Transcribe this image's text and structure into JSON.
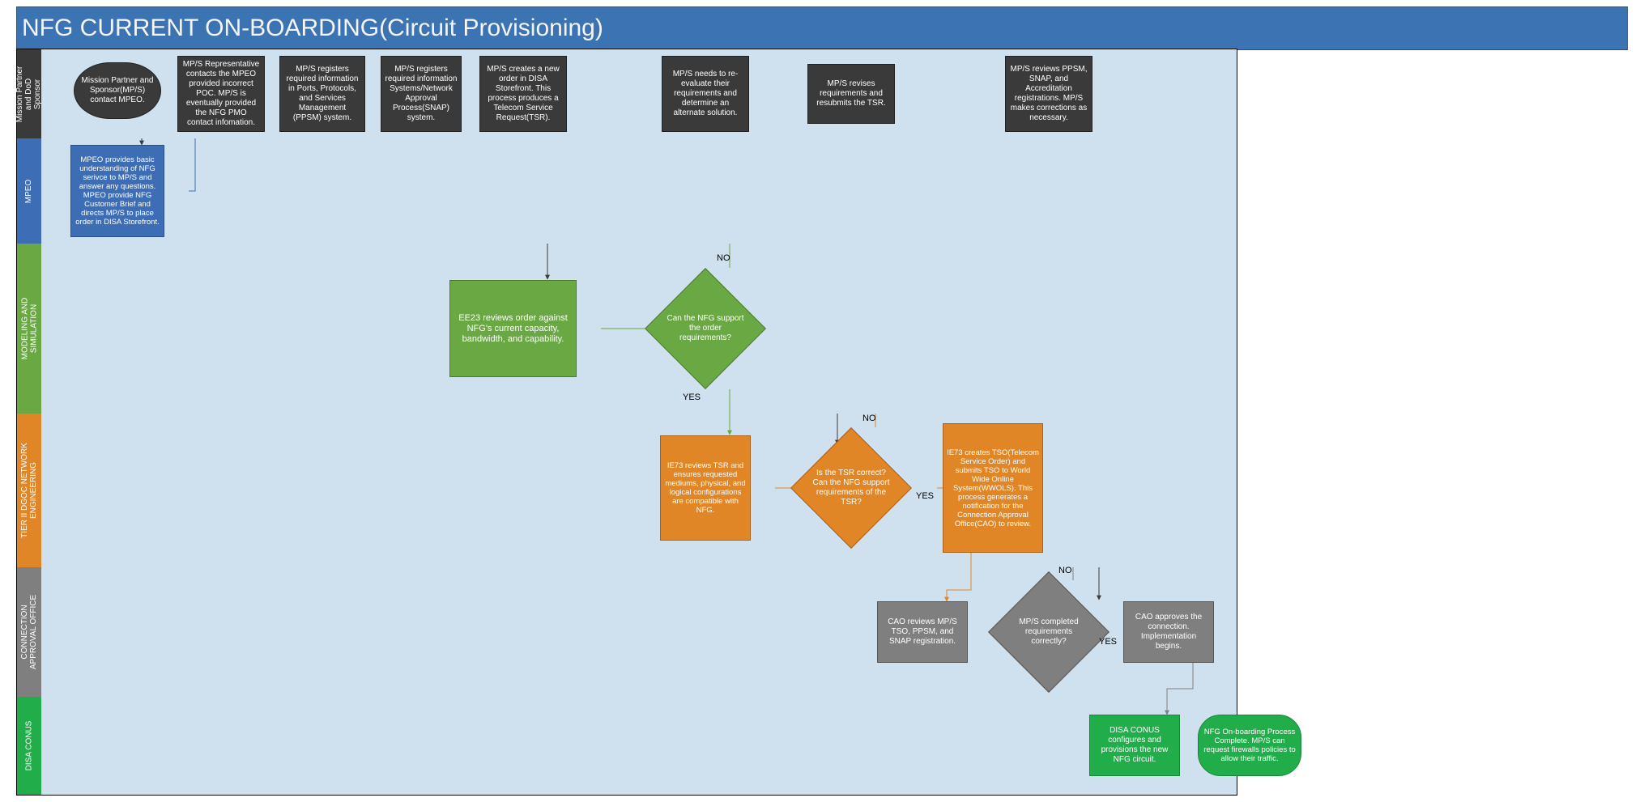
{
  "title": "NFG CURRENT ON-BOARDING(Circuit Provisioning)",
  "lanes": {
    "mp": "Mission Partner\nand DoD\nSponsor",
    "mpeo": "MPEO",
    "ms": "MODELING AND\nSIMULATION",
    "ne": "TIER II DGOC NETWORK\nENGINEERING",
    "cao": "CONNECTION\nAPPROVAL OFFICE",
    "dc": "DISA CONUS"
  },
  "nodes": {
    "a1": "Mission Partner and Sponsor(MP/S) contact MPEO.",
    "a2": "MP/S Representative contacts the MPEO provided incorrect POC. MP/S is eventually provided the NFG PMO contact infomation.",
    "a3": "MP/S  registers required information in Ports, Protocols, and Services Management (PPSM) system.",
    "a4": "MP/S  registers required information Systems/Network Approval Process(SNAP) system.",
    "a5": "MP/S creates a new order in DISA Storefront. This process produces a Telecom Service Request(TSR).",
    "a6": "MP/S needs to re-evaluate their requirements and determine an alternate solution.",
    "a7": "MP/S revises requirements and resubmits the TSR.",
    "a8": "MP/S reviews PPSM, SNAP, and Accreditation registrations. MP/S makes corrections as necessary.",
    "b1": "MPEO provides basic understanding of NFG serivce to MP/S and answer any questions. MPEO provide NFG Customer Brief and directs MP/S to place order in DISA Storefront.",
    "c1": "EE23 reviews order against NFG's current capacity, bandwidth, and capability.",
    "d1": "Can the NFG support the order requirements?",
    "e1": "IE73 reviews TSR and ensures requested mediums, physical, and logical configurations are compatible with NFG.",
    "d2": "Is the TSR correct? Can the NFG support requirements of the TSR?",
    "e2": "IE73 creates TSO(Telecom Service Order) and submits TSO to World Wide Online System(WWOLS). This process generates a notification for the Connection Approval Office(CAO) to review.",
    "f1": "CAO reviews MP/S TSO, PPSM, and SNAP registration.",
    "d3": "MP/S completed requirements correctly?",
    "f2": "CAO approves the connection. Implementation begins.",
    "g1": "DISA CONUS configures and provisions the new NFG circuit.",
    "g2": "NFG On-boarding Process Complete. MP/S can request firewalls policies to allow their traffic."
  },
  "labels": {
    "yes": "YES",
    "no": "NO"
  }
}
